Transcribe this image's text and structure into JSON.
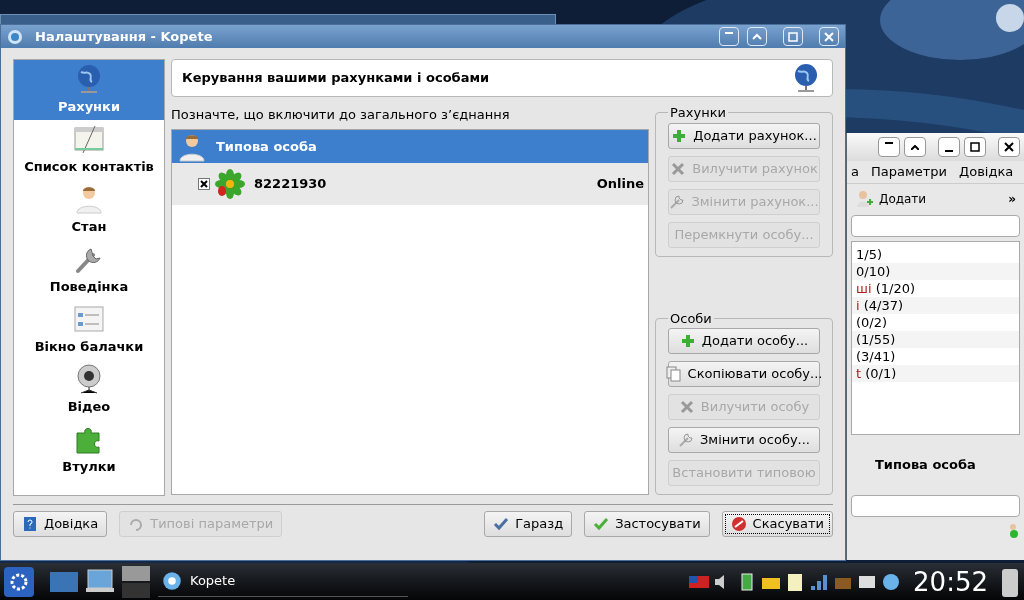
{
  "dialog": {
    "title": "Налаштування - Kopete",
    "sidebar": {
      "items": [
        {
          "label": "Рахунки",
          "kind": "globe",
          "selected": true
        },
        {
          "label": "Список контактів",
          "kind": "list",
          "selected": false
        },
        {
          "label": "Стан",
          "kind": "person",
          "selected": false
        },
        {
          "label": "Поведінка",
          "kind": "wrench",
          "selected": false
        },
        {
          "label": "Вікно балачки",
          "kind": "chat",
          "selected": false
        },
        {
          "label": "Відео",
          "kind": "webcam",
          "selected": false
        },
        {
          "label": "Втулки",
          "kind": "puzzle",
          "selected": false
        }
      ]
    },
    "header": "Керування вашими рахунками і особами",
    "subtitle": "Позначте, що включити до загального з’єднання",
    "tree": [
      {
        "label": "Типова особа",
        "selected": true,
        "children": [
          {
            "label": "82221930",
            "status": "Online",
            "checked": true,
            "selected": false
          }
        ]
      }
    ],
    "groups": [
      {
        "title": "Рахунки",
        "buttons": [
          {
            "label": "Додати рахунок...",
            "kind": "add",
            "disabled": false
          },
          {
            "label": "Вилучити рахунок",
            "kind": "remove",
            "disabled": true
          },
          {
            "label": "Змінити рахунок...",
            "kind": "edit",
            "disabled": true
          },
          {
            "label": "Перемкнути особу...",
            "kind": "plain",
            "disabled": true
          }
        ]
      },
      {
        "title": "Особи",
        "buttons": [
          {
            "label": "Додати особу...",
            "kind": "add",
            "disabled": false
          },
          {
            "label": "Скопіювати особу...",
            "kind": "copy",
            "disabled": false
          },
          {
            "label": "Вилучити особу",
            "kind": "remove",
            "disabled": true
          },
          {
            "label": "Змінити особу...",
            "kind": "edit",
            "disabled": false
          },
          {
            "label": "Встановити типовою",
            "kind": "plain",
            "disabled": true
          }
        ]
      }
    ],
    "footer_left": [
      {
        "label": "Довідка",
        "kind": "help",
        "disabled": false,
        "focused": false
      },
      {
        "label": "Типові параметри",
        "kind": "reset",
        "disabled": true,
        "focused": false
      }
    ],
    "footer_right": [
      {
        "label": "Гаразд",
        "kind": "ok",
        "disabled": false,
        "focused": false
      },
      {
        "label": "Застосувати",
        "kind": "apply",
        "disabled": false,
        "focused": false
      },
      {
        "label": "Скасувати",
        "kind": "cancel",
        "disabled": false,
        "focused": true
      }
    ]
  },
  "background_window": {
    "menu": [
      "а",
      "Параметри",
      "Довідка"
    ],
    "toolbar_button": "Додати",
    "overflow": "»",
    "groups": [
      {
        "count": "1/5)"
      },
      {
        "count": "0/10)"
      },
      {
        "name": "ші",
        "count": "(1/20)"
      },
      {
        "name": "і",
        "count": "(4/37)"
      },
      {
        "count": "(0/2)"
      },
      {
        "count": "(1/55)"
      },
      {
        "count": "(3/41)"
      },
      {
        "name": "t",
        "count": "(0/1)"
      }
    ],
    "identity": "Типова особа"
  },
  "taskbar": {
    "task": "Kopete",
    "clock": "20:52"
  }
}
